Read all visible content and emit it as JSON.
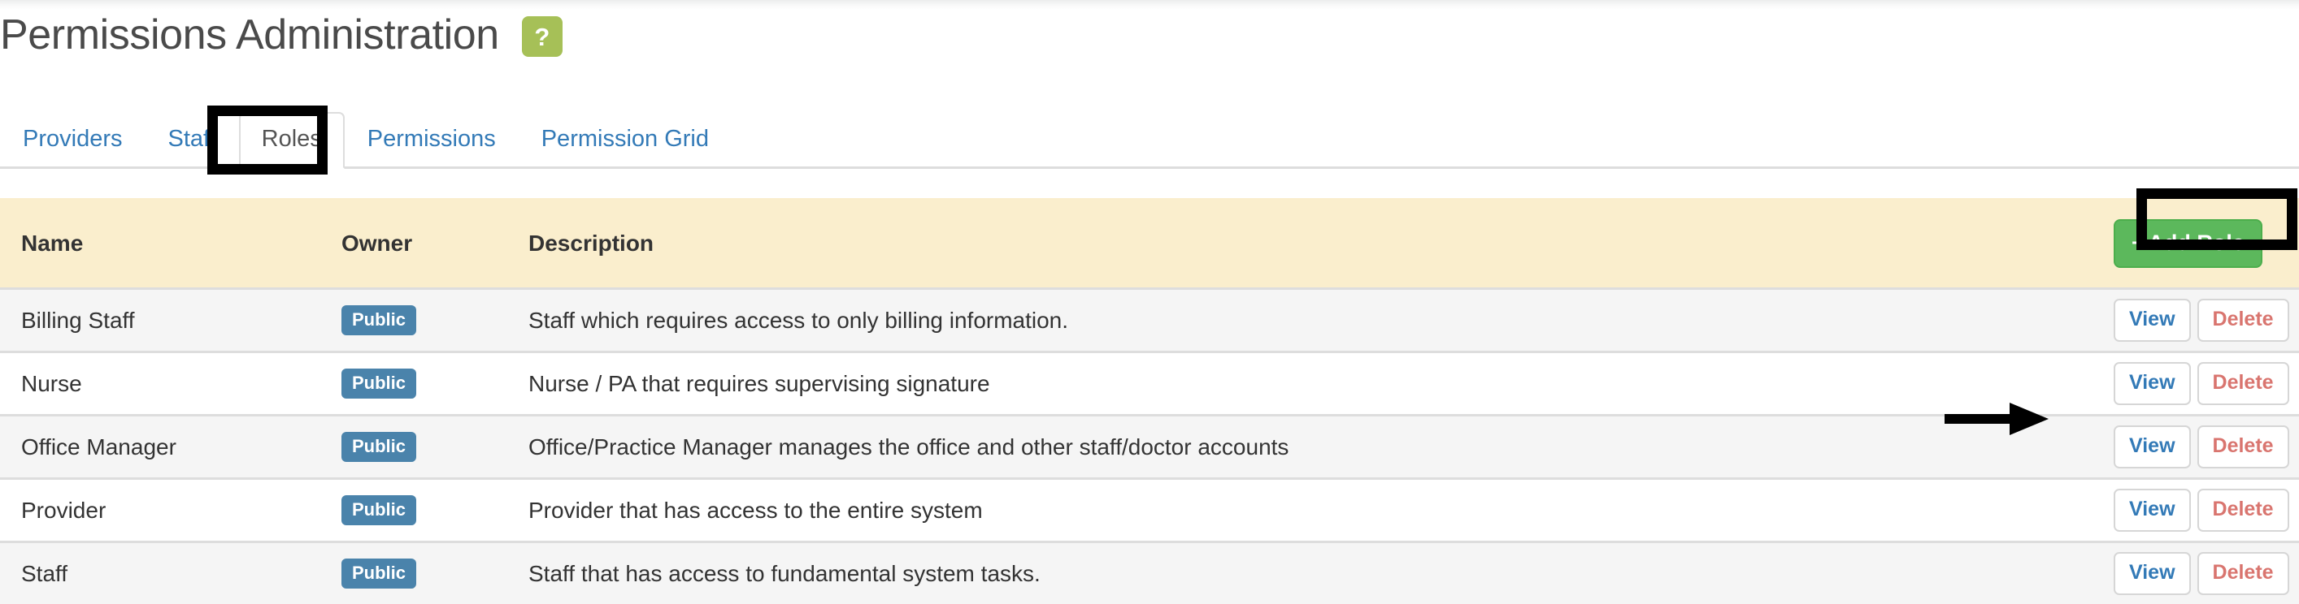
{
  "header": {
    "title": "Permissions Administration",
    "help_badge_label": "?",
    "help_badge_color": "#a6c057"
  },
  "tabs": [
    {
      "label": "Providers",
      "active": false
    },
    {
      "label": "Staff",
      "active": false
    },
    {
      "label": "Roles",
      "active": true
    },
    {
      "label": "Permissions",
      "active": false
    },
    {
      "label": "Permission Grid",
      "active": false
    }
  ],
  "toolbar": {
    "add_role_label": "Add Role",
    "add_role_plus": "+",
    "add_role_color": "#5cb85c"
  },
  "table": {
    "header_background": "#faeecd",
    "columns": [
      "Name",
      "Owner",
      "Description",
      ""
    ],
    "rows": [
      {
        "name": "Billing Staff",
        "owner": "Public",
        "description": "Staff which requires access to only billing information.",
        "view_label": "View",
        "delete_label": "Delete"
      },
      {
        "name": "Nurse",
        "owner": "Public",
        "description": "Nurse / PA that requires supervising signature",
        "view_label": "View",
        "delete_label": "Delete"
      },
      {
        "name": "Office Manager",
        "owner": "Public",
        "description": "Office/Practice Manager manages the office and other staff/doctor accounts",
        "view_label": "View",
        "delete_label": "Delete"
      },
      {
        "name": "Provider",
        "owner": "Public",
        "description": "Provider that has access to the entire system",
        "view_label": "View",
        "delete_label": "Delete"
      },
      {
        "name": "Staff",
        "owner": "Public",
        "description": "Staff that has access to fundamental system tasks.",
        "view_label": "View",
        "delete_label": "Delete"
      }
    ]
  },
  "colors": {
    "link": "#337ab7",
    "badge_public": "#4a83ab",
    "delete_text": "#d9756f",
    "row_stripe": "#f5f5f5",
    "annotation": "#000000"
  }
}
